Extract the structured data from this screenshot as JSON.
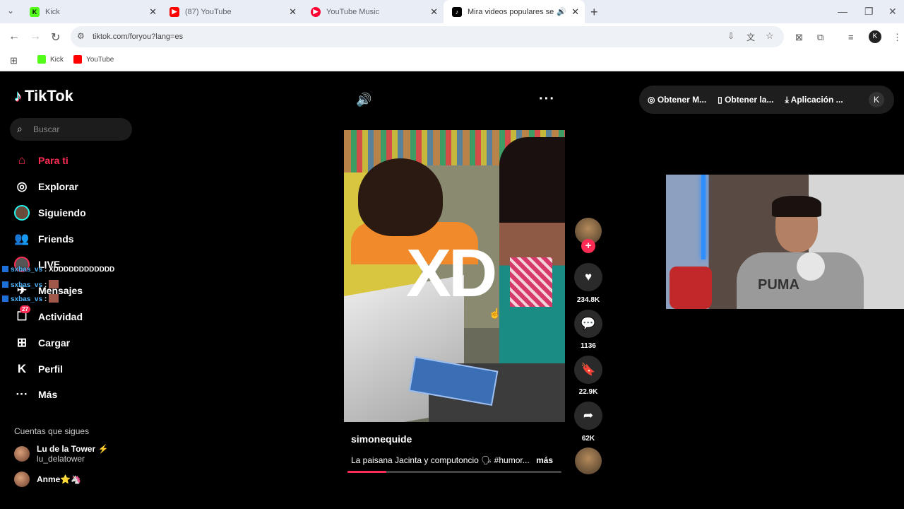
{
  "browser": {
    "tabs": [
      {
        "title": "Kick",
        "favicon_color": "#53fc18",
        "active": false
      },
      {
        "title": "(87) YouTube",
        "favicon_color": "#ff0000",
        "active": false
      },
      {
        "title": "YouTube Music",
        "favicon_color": "#ff0033",
        "active": false
      },
      {
        "title": "Mira videos populares selec",
        "favicon_color": "#000000",
        "active": true
      }
    ],
    "url": "tiktok.com/foryou?lang=es",
    "bookmarks": [
      {
        "label": "Kick",
        "color": "#53fc18"
      },
      {
        "label": "YouTube",
        "color": "#ff0000"
      }
    ]
  },
  "tiktok": {
    "logo": "TikTok",
    "search_placeholder": "Buscar",
    "nav": [
      {
        "label": "Para ti",
        "icon": "home-icon",
        "active": true
      },
      {
        "label": "Explorar",
        "icon": "compass-icon"
      },
      {
        "label": "Siguiendo",
        "icon": "following-icon"
      },
      {
        "label": "Friends",
        "icon": "friends-icon"
      },
      {
        "label": "LIVE",
        "icon": "live-icon"
      },
      {
        "label": "Mensajes",
        "icon": "messages-icon"
      },
      {
        "label": "Actividad",
        "icon": "activity-icon",
        "badge": "27"
      },
      {
        "label": "Cargar",
        "icon": "upload-icon"
      },
      {
        "label": "Perfil",
        "icon": "profile-icon"
      },
      {
        "label": "Más",
        "icon": "more-icon"
      }
    ],
    "following_title": "Cuentas que sigues",
    "following": [
      {
        "name": "Lu de la Tower ⚡",
        "handle": "lu_delatower"
      },
      {
        "name": "Anme⭐🦄",
        "handle": ""
      }
    ],
    "topbar": {
      "b1": "Obtener M...",
      "b2": "Obtener la...",
      "b3": "Aplicación ...",
      "avatar_letter": "K"
    },
    "video": {
      "overlay_text": "XD",
      "author": "simonequide",
      "description": "La paisana Jacinta y computoncio 🗣 #humor...",
      "more": "más",
      "progress": 0.18
    },
    "actions": {
      "likes": "234.8K",
      "comments": "1136",
      "saves": "22.9K",
      "shares": "62K"
    }
  },
  "chat_overlay": [
    {
      "user": "sxbas_vs",
      "msg": "XDDDDDDDDDDDD"
    },
    {
      "user": "sxbas_vs",
      "msg": ""
    },
    {
      "user": "sxbas_vs",
      "msg": ""
    }
  ],
  "webcam": {
    "shirt_text": "PUMA"
  }
}
